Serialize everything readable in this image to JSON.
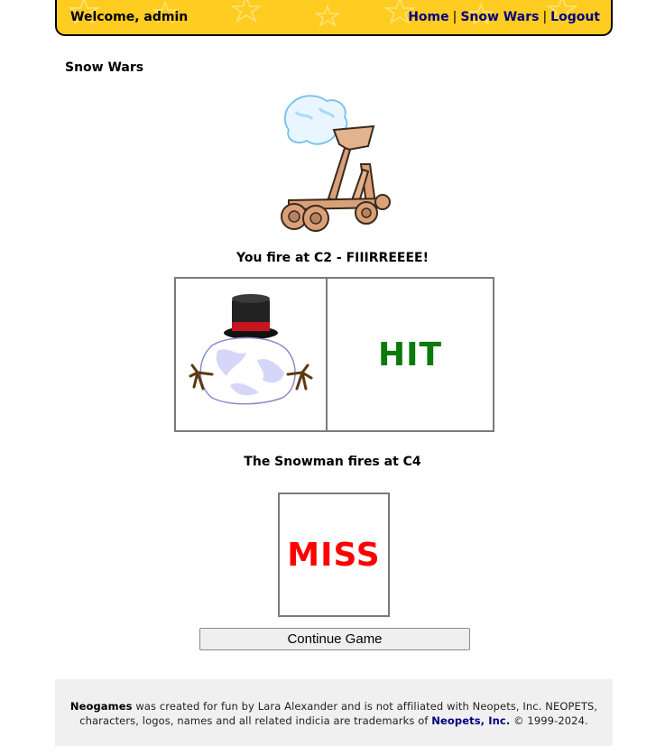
{
  "header": {
    "welcome": "Welcome, admin",
    "nav": [
      {
        "label": "Home"
      },
      {
        "label": "Snow Wars"
      },
      {
        "label": "Logout"
      }
    ],
    "separator": "|",
    "background_color": "#ffcc22",
    "link_color": "#000080"
  },
  "page": {
    "title": "Snow Wars"
  },
  "player_turn": {
    "message": "You fire at C2 - FIIIRREEEE!",
    "result": "HIT",
    "result_color": "#0a7a0a",
    "icons": [
      "catapult-icon",
      "snowman-icon"
    ]
  },
  "enemy_turn": {
    "message": "The Snowman fires at C4",
    "result": "MISS",
    "result_color": "#ff0000"
  },
  "actions": {
    "continue_label": "Continue Game"
  },
  "footer": {
    "brand": "Neogames",
    "text_1": " was created for fun by Lara Alexander and is not affiliated with Neopets, Inc. NEOPETS,",
    "text_2": "characters, logos, names and all related indicia are trademarks of ",
    "link": "Neopets, Inc.",
    "text_3": " © 1999-2024."
  }
}
